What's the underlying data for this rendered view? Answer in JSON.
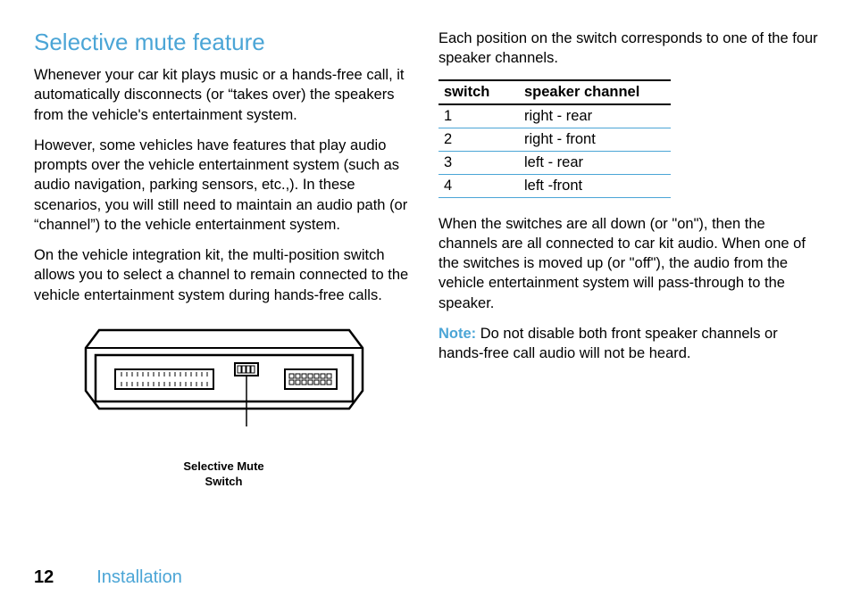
{
  "heading": "Selective mute feature",
  "left": {
    "p1": "Whenever your car kit plays music or a hands-free call, it automatically disconnects (or “takes over) the speakers from the vehicle's entertainment system.",
    "p2": "However, some vehicles have features that play audio prompts over the vehicle entertainment system (such as audio navigation, parking sensors, etc.,). In these scenarios, you will still need to maintain an audio path (or “channel”) to the vehicle entertainment system.",
    "p3": "On the vehicle integration kit, the multi-position switch allows you to select a channel to remain connected to the vehicle entertainment system during hands-free calls.",
    "figcap1": "Selective Mute",
    "figcap2": "Switch"
  },
  "right": {
    "p1": "Each position on the switch corresponds to one of the four speaker channels.",
    "table": {
      "h1": "switch",
      "h2": "speaker channel",
      "rows": [
        {
          "sw": "1",
          "sp": "right - rear"
        },
        {
          "sw": "2",
          "sp": "right - front"
        },
        {
          "sw": "3",
          "sp": "left - rear"
        },
        {
          "sw": "4",
          "sp": "left -front"
        }
      ]
    },
    "p2": "When the switches are all down (or \"on\"), then the channels are all connected to car kit audio. When one of the switches is moved up (or \"off\"), the audio from the vehicle entertainment system will pass-through to the speaker.",
    "noteLabel": "Note:",
    "noteText": " Do not disable both front speaker channels or hands-free call audio will not be heard."
  },
  "footer": {
    "page": "12",
    "section": "Installation"
  }
}
